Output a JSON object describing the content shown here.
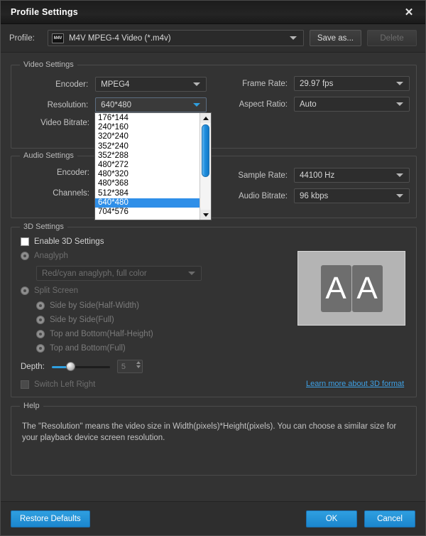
{
  "window": {
    "title": "Profile Settings",
    "close_icon": "close-icon"
  },
  "profile_bar": {
    "label": "Profile:",
    "icon_text": "M4V",
    "value": "M4V MPEG-4 Video (*.m4v)",
    "save_as_label": "Save as...",
    "delete_label": "Delete"
  },
  "video_settings": {
    "group_title": "Video Settings",
    "encoder_label": "Encoder:",
    "encoder_value": "MPEG4",
    "resolution_label": "Resolution:",
    "resolution_value": "640*480",
    "video_bitrate_label": "Video Bitrate:",
    "frame_rate_label": "Frame Rate:",
    "frame_rate_value": "29.97 fps",
    "aspect_ratio_label": "Aspect Ratio:",
    "aspect_ratio_value": "Auto",
    "resolution_options": [
      "176*144",
      "240*160",
      "320*240",
      "352*240",
      "352*288",
      "480*272",
      "480*320",
      "480*368",
      "512*384",
      "640*480",
      "704*576"
    ],
    "resolution_selected_index": 9
  },
  "audio_settings": {
    "group_title": "Audio Settings",
    "encoder_label": "Encoder:",
    "channels_label": "Channels:",
    "sample_rate_label": "Sample Rate:",
    "sample_rate_value": "44100 Hz",
    "audio_bitrate_label": "Audio Bitrate:",
    "audio_bitrate_value": "96 kbps"
  },
  "three_d_settings": {
    "group_title": "3D Settings",
    "enable_label": "Enable 3D Settings",
    "anaglyph_label": "Anaglyph",
    "anaglyph_mode_value": "Red/cyan anaglyph, full color",
    "split_screen_label": "Split Screen",
    "split_options": [
      "Side by Side(Half-Width)",
      "Side by Side(Full)",
      "Top and Bottom(Half-Height)",
      "Top and Bottom(Full)"
    ],
    "depth_label": "Depth:",
    "depth_value": "5",
    "switch_left_right_label": "Switch Left Right",
    "learn_more_label": "Learn more about 3D format",
    "preview_letter_left": "A",
    "preview_letter_right": "A"
  },
  "help": {
    "group_title": "Help",
    "text": "The \"Resolution\" means the video size in Width(pixels)*Height(pixels).  You can choose a similar size for your playback device screen resolution."
  },
  "footer": {
    "restore_defaults_label": "Restore Defaults",
    "ok_label": "OK",
    "cancel_label": "Cancel"
  },
  "colors": {
    "accent_blue": "#2f9fe0",
    "dialog_bg": "#333333",
    "titlebar_bg": "#1c1c1c",
    "link_blue": "#3ea0e4",
    "selection_blue": "#2f8fe8"
  }
}
